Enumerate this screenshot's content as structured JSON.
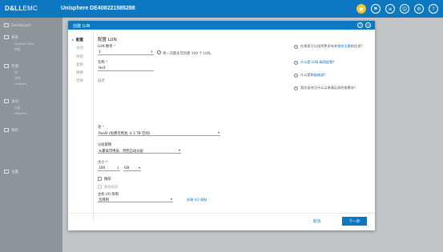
{
  "topbar": {
    "brand": "D&LL",
    "brand_suffix": "EMC",
    "system_title": "Unisphere DE408221585288",
    "icons": [
      "alert-bell-icon",
      "notification-icon",
      "list-icon",
      "user-icon",
      "settings-icon",
      "help-icon"
    ],
    "accent": "#0d77c2"
  },
  "leftnav": {
    "items": [
      {
        "label": "Dashboard"
      },
      {
        "label": "系统"
      },
      {
        "label": "存储"
      },
      {
        "label": "访问"
      },
      {
        "label": "保护"
      },
      {
        "label": "设置"
      }
    ],
    "subitems": [
      "System View",
      "性能",
      "块",
      "文件",
      "VMware",
      "主机",
      "VMware"
    ]
  },
  "dialog": {
    "title": "创建 LUN",
    "steps": [
      "配置",
      "访问",
      "快照",
      "复制",
      "摘要",
      "结果"
    ],
    "active_step": 0,
    "form": {
      "section_title": "配置 LUN",
      "lun_count_label": "LUN 数目",
      "lun_count_value": "1",
      "lun_count_note": "将一次最多可创建 100 个 LUN。",
      "name_label": "名称",
      "name_value": "test",
      "description_label": "描述",
      "pool_label": "池",
      "pool_value": "Pool0 (免费可用池, 4.3 TB 空闲)",
      "tiering_label": "分层策略",
      "tiering_value": "从最高可用层，然后自动分层",
      "size_label": "大小",
      "size_value": "100",
      "size_unit": "GB",
      "thin_label": "精简",
      "dedup_label": "数据缩减",
      "host_io_label": "主机 I/O 限制",
      "host_io_value": "无限制",
      "host_io_link": "创建 I/O 限制"
    },
    "help": [
      {
        "text": "在哪里可以找到更多有关",
        "link": "相关主题",
        "rest": "的信息?"
      },
      {
        "text": "",
        "link": "什么是 LUN 精简配置",
        "rest": "?"
      },
      {
        "text": "什么是",
        "link": "数据缩减",
        "rest": "?"
      },
      {
        "text": "我应该关注什么以便满足高性能需求？",
        "link": "",
        "rest": ""
      }
    ],
    "footer": {
      "cancel_label": "取消",
      "next_label": "下一步"
    }
  }
}
